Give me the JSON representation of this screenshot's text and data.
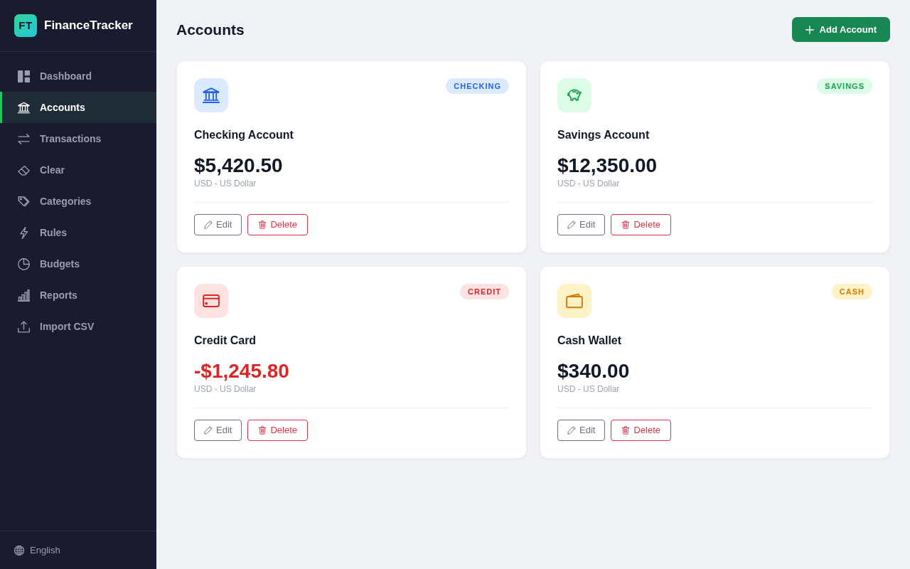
{
  "app": {
    "logo": "FT",
    "name": "FinanceTracker"
  },
  "sidebar": {
    "items": [
      {
        "label": "Dashboard",
        "selected": false
      },
      {
        "label": "Accounts",
        "selected": true
      },
      {
        "label": "Transactions",
        "selected": false
      },
      {
        "label": "Clear",
        "selected": false
      },
      {
        "label": "Categories",
        "selected": false
      },
      {
        "label": "Rules",
        "selected": false
      },
      {
        "label": "Budgets",
        "selected": false
      },
      {
        "label": "Reports",
        "selected": false
      },
      {
        "label": "Import CSV",
        "selected": false
      }
    ],
    "language": "English"
  },
  "page": {
    "title": "Accounts",
    "add_button": "Add Account"
  },
  "accounts": [
    {
      "kind": "checking",
      "badge": "CHECKING",
      "name": "Checking Account",
      "balance": "$5,420.50",
      "negative": false,
      "currency": "USD - US Dollar",
      "edit_label": "Edit",
      "delete_label": "Delete"
    },
    {
      "kind": "savings",
      "badge": "SAVINGS",
      "name": "Savings Account",
      "balance": "$12,350.00",
      "negative": false,
      "currency": "USD - US Dollar",
      "edit_label": "Edit",
      "delete_label": "Delete"
    },
    {
      "kind": "credit",
      "badge": "CREDIT",
      "name": "Credit Card",
      "balance": "-$1,245.80",
      "negative": true,
      "currency": "USD - US Dollar",
      "edit_label": "Edit",
      "delete_label": "Delete"
    },
    {
      "kind": "cash",
      "badge": "CASH",
      "name": "Cash Wallet",
      "balance": "$340.00",
      "negative": false,
      "currency": "USD - US Dollar",
      "edit_label": "Edit",
      "delete_label": "Delete"
    }
  ]
}
